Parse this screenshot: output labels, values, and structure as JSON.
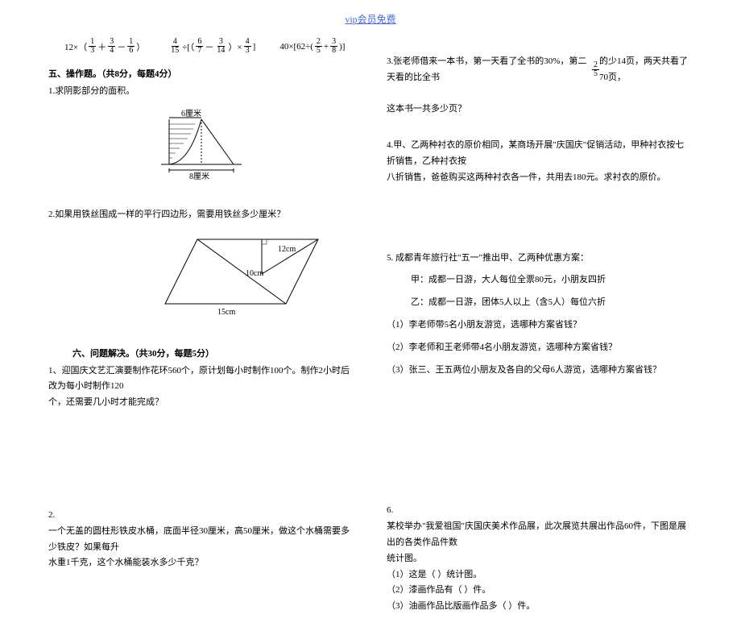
{
  "header": {
    "link": "vip会员免费"
  },
  "left": {
    "section5_title": "五、操作题。（共8分，每题4分）",
    "p1": "1.求阴影部分的面积。",
    "fig1_top": "6厘米",
    "fig1_bottom": "8厘米",
    "p2": "2.如果用铁丝围成一样的平行四边形，需要用铁丝多少厘米？",
    "fig2_a": "12cm",
    "fig2_b": "10cm",
    "fig2_c": "15cm",
    "section6_title": "六、问题解决。（共30分，每题5分）",
    "p6_1a": "1、迎国庆文艺汇演要制作花环560个，原计划每小时制作100个。制作2小时后改为每小时制作120",
    "p6_1b": "个，还需要几小时才能完成？",
    "p6_2": "2.",
    "p6_2a": "一个无盖的圆柱形铁皮水桶，底面半径30厘米，高50厘米，做这个水桶需要多少铁皮？如果每升",
    "p6_2b": "水重1千克，这个水桶能装水多少千克？"
  },
  "right": {
    "p3a": "3.张老师借来一本书，第一天看了全书的30%，第二天看的比全书",
    "p3b": "的少14页，两天共看了70页，",
    "p3c": "这本书一共多少页？",
    "p4a": "4.甲、乙两种衬衣的原价相同，某商场开展\"庆国庆\"促销活动，甲种衬衣按七折销售，乙种衬衣按",
    "p4b": "八折销售，爸爸购买这两种衬衣各一件，共用去180元。求衬衣的原价。",
    "p5_title": "5.   成都青年旅行社\"五一\"推出甲、乙两种优惠方案：",
    "p5_a": "甲：成都一日游，大人每位全票80元，小朋友四折",
    "p5_b": "乙：成都一日游，团体5人以上（含5人）每位六折",
    "p5_1": "（1）李老师带5名小朋友游览，选哪种方案省钱？",
    "p5_2": "（2）李老师和王老师带4名小朋友游览，选哪种方案省钱？",
    "p5_3": "（3）张三、王五两位小朋友及各自的父母6人游览，选哪种方案省钱？",
    "p6": "6.",
    "p6a": "某校举办\"我爱祖国\"庆国庆美术作品展，此次展览共展出作品60件，下图是展出的各类作品件数",
    "p6b": "统计图。",
    "p6_1": "（1）这是（     ）统计图。",
    "p6_2": "（2）漆画作品有（     ）件。",
    "p6_3": "（3）油画作品比版画作品多（       ）件。"
  },
  "math": {
    "e1_a": "12×（",
    "e1_b": "）",
    "e2_a": "÷[（",
    "e2_b": "）×",
    "e2_c": "]",
    "e3_a": "40×[62÷(",
    "e3_b": ")]"
  }
}
